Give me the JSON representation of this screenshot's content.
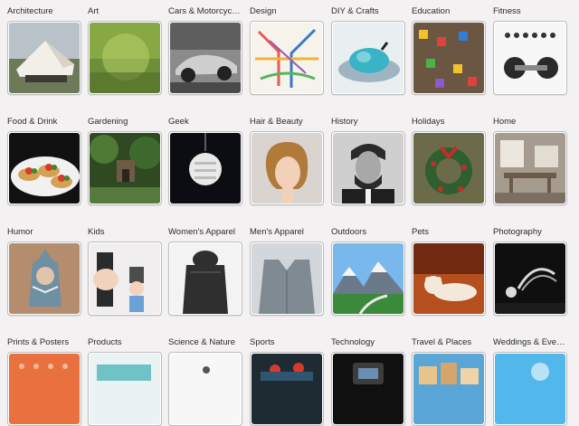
{
  "categories": [
    {
      "label": "Architecture",
      "icon": "architecture-icon"
    },
    {
      "label": "Art",
      "icon": "art-icon"
    },
    {
      "label": "Cars & Motorcyc…",
      "icon": "car-icon"
    },
    {
      "label": "Design",
      "icon": "design-icon"
    },
    {
      "label": "DIY & Crafts",
      "icon": "crafts-icon"
    },
    {
      "label": "Education",
      "icon": "education-icon"
    },
    {
      "label": "Fitness",
      "icon": "fitness-icon"
    },
    {
      "label": "Food & Drink",
      "icon": "food-icon"
    },
    {
      "label": "Gardening",
      "icon": "garden-icon"
    },
    {
      "label": "Geek",
      "icon": "geek-icon"
    },
    {
      "label": "Hair & Beauty",
      "icon": "hair-icon"
    },
    {
      "label": "History",
      "icon": "history-icon"
    },
    {
      "label": "Holidays",
      "icon": "holidays-icon"
    },
    {
      "label": "Home",
      "icon": "home-icon"
    },
    {
      "label": "Humor",
      "icon": "humor-icon"
    },
    {
      "label": "Kids",
      "icon": "kids-icon"
    },
    {
      "label": "Women's Apparel",
      "icon": "womens-apparel-icon"
    },
    {
      "label": "Men's Apparel",
      "icon": "mens-apparel-icon"
    },
    {
      "label": "Outdoors",
      "icon": "outdoors-icon"
    },
    {
      "label": "Pets",
      "icon": "pets-icon"
    },
    {
      "label": "Photography",
      "icon": "photography-icon"
    },
    {
      "label": "Prints & Posters",
      "icon": "prints-icon"
    },
    {
      "label": "Products",
      "icon": "products-icon"
    },
    {
      "label": "Science & Nature",
      "icon": "science-icon"
    },
    {
      "label": "Sports",
      "icon": "sports-icon"
    },
    {
      "label": "Technology",
      "icon": "technology-icon"
    },
    {
      "label": "Travel & Places",
      "icon": "travel-icon"
    },
    {
      "label": "Weddings & Eve…",
      "icon": "weddings-icon"
    }
  ],
  "colors": {
    "background": "#f3f1f1",
    "thumb_border": "#bdbdbd",
    "label_text": "#2b2b2b"
  }
}
